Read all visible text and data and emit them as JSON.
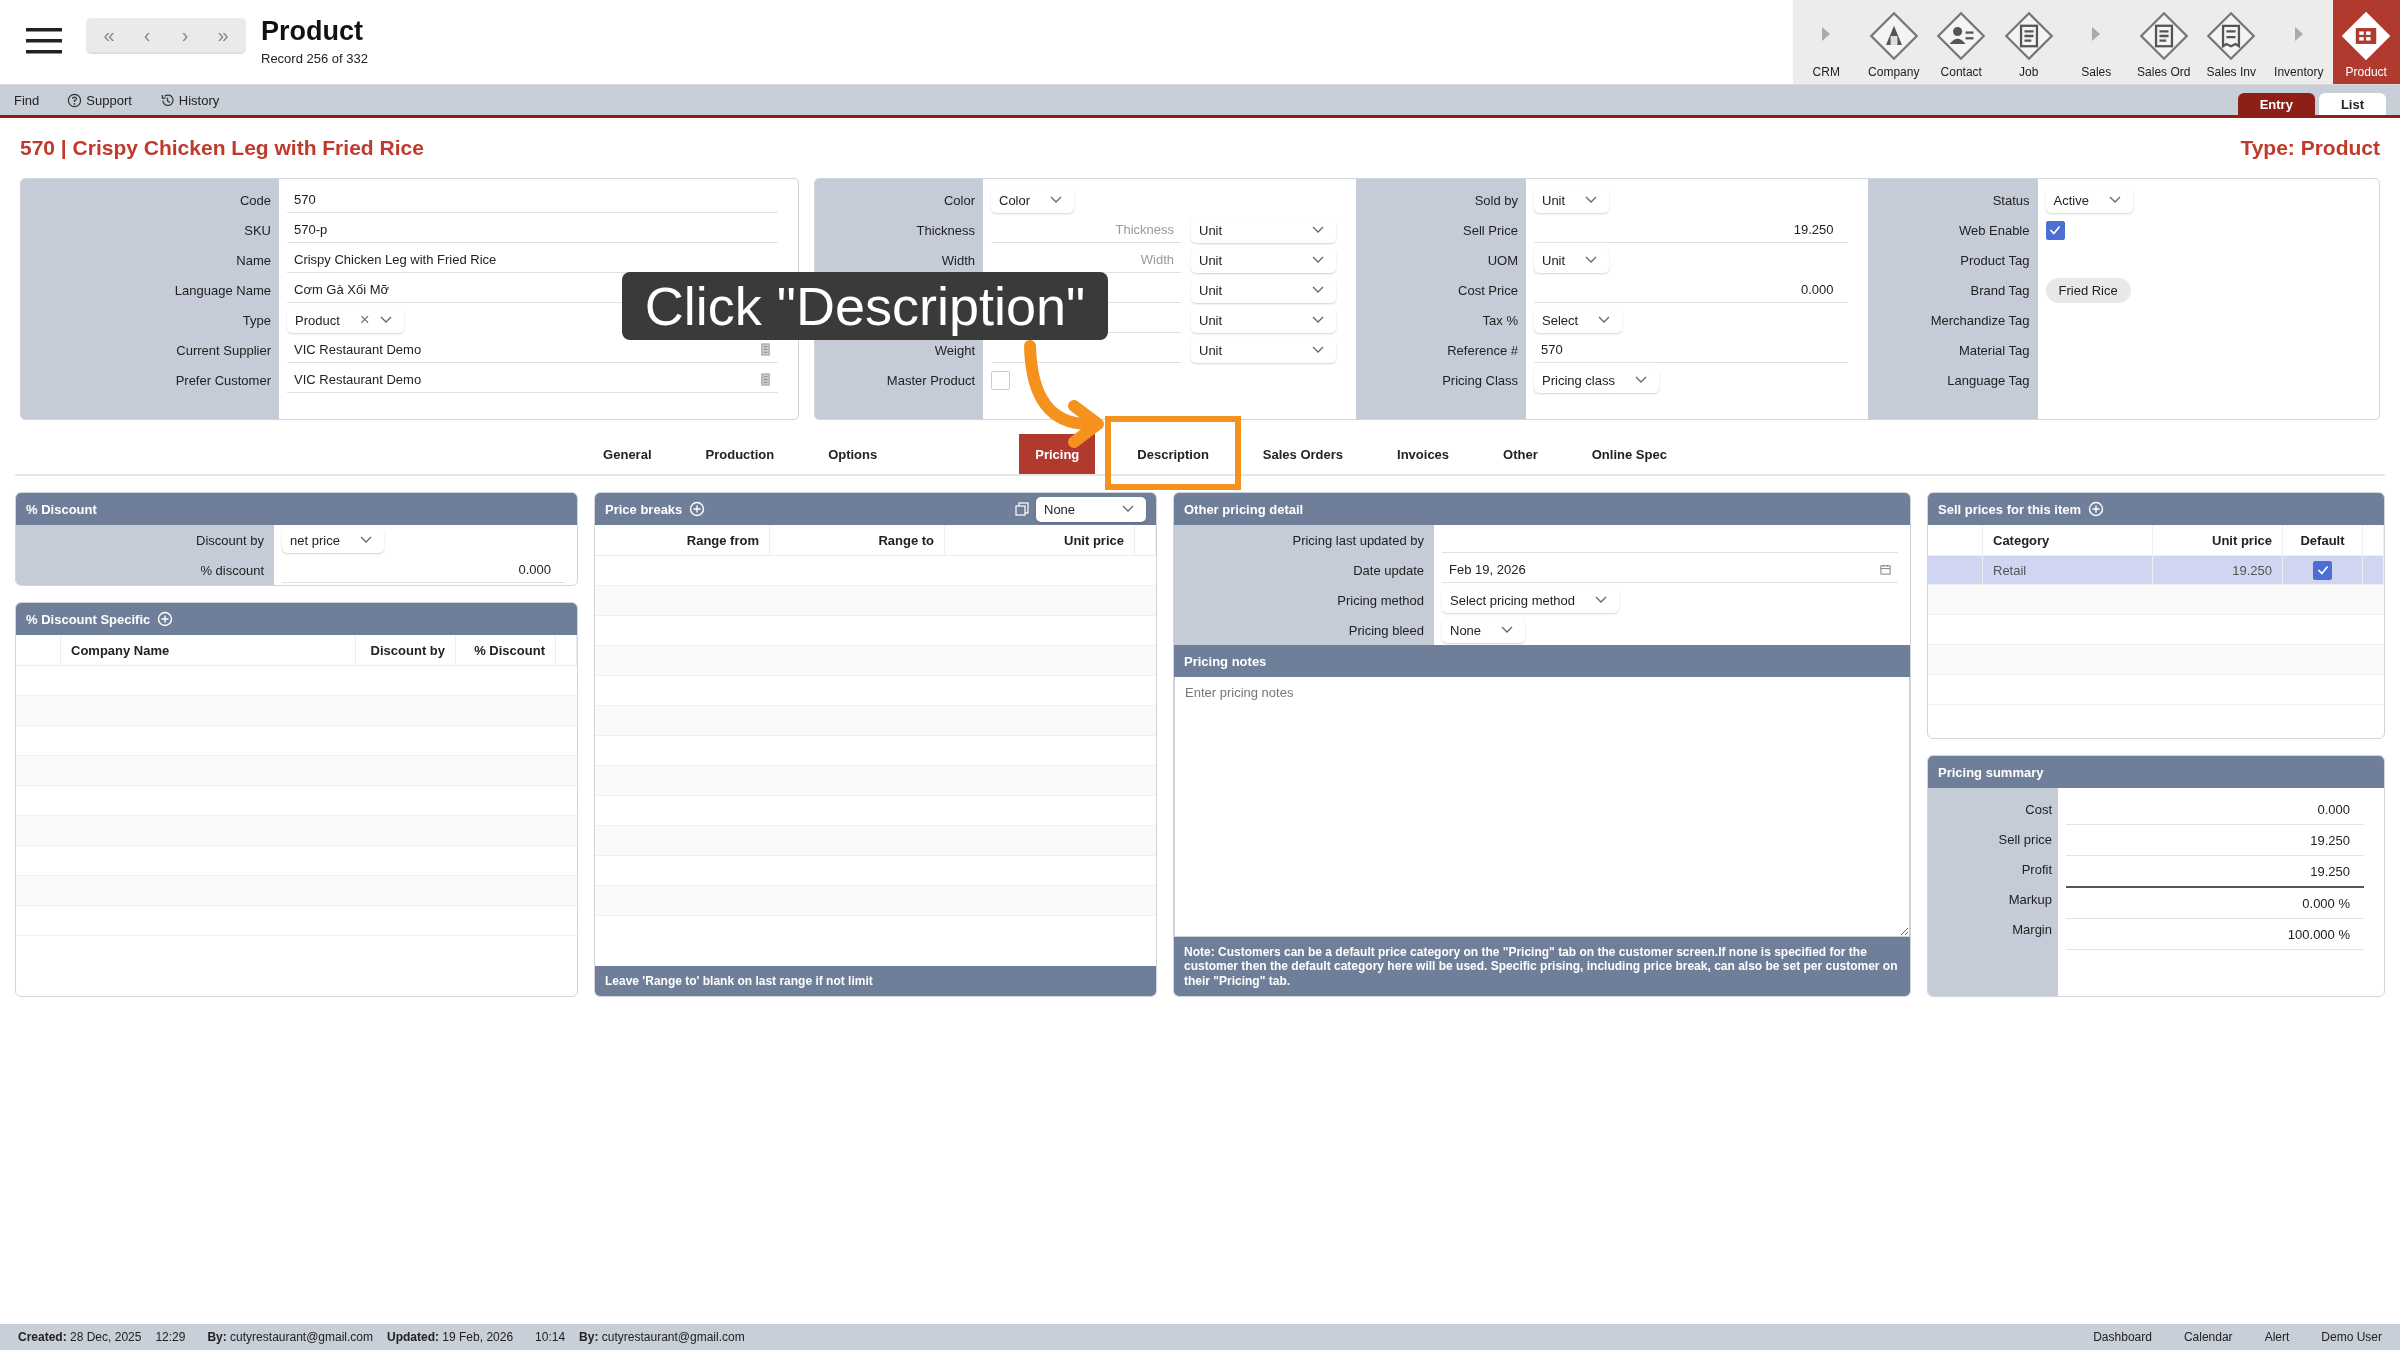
{
  "top_bar": {
    "nav_buttons": [
      "«",
      "‹",
      "›",
      "»"
    ],
    "title": "Product",
    "subtitle": "Record 256 of 332"
  },
  "modules": [
    {
      "label": "CRM",
      "kind": "group",
      "selected": false
    },
    {
      "label": "Company",
      "kind": "module",
      "selected": false
    },
    {
      "label": "Contact",
      "kind": "module",
      "selected": false
    },
    {
      "label": "Job",
      "kind": "module",
      "selected": false
    },
    {
      "label": "Sales",
      "kind": "group",
      "selected": false
    },
    {
      "label": "Sales Ord",
      "kind": "module",
      "selected": false
    },
    {
      "label": "Sales Inv",
      "kind": "module",
      "selected": false
    },
    {
      "label": "Inventory",
      "kind": "group",
      "selected": false
    },
    {
      "label": "Product",
      "kind": "module",
      "selected": true
    }
  ],
  "toolbar": [
    {
      "label": "Find",
      "kind": "plain"
    },
    {
      "label": "Support",
      "kind": "help"
    },
    {
      "label": "History",
      "kind": "history"
    }
  ],
  "view_tabs": [
    {
      "label": "Entry",
      "selected": true
    },
    {
      "label": "List",
      "selected": false
    }
  ],
  "record_heading": "570 | Crispy Chicken Leg with Fried Rice",
  "record_type": "Type: Product",
  "form_panels": [
    {
      "rows": [
        {
          "label": "Code",
          "kind": "text",
          "value": "570"
        },
        {
          "label": "SKU",
          "kind": "text",
          "value": "570-p"
        },
        {
          "label": "Name",
          "kind": "text",
          "value": "Crispy Chicken Leg with Fried Rice"
        },
        {
          "label": "Language Name",
          "kind": "text",
          "value": "Cơm Gà Xối Mỡ"
        },
        {
          "label": "Type",
          "kind": "select-clear",
          "value": "Product",
          "clear": "×"
        },
        {
          "label": "Current Supplier",
          "kind": "lookup",
          "value": "VIC Restaurant Demo"
        },
        {
          "label": "Prefer Customer",
          "kind": "lookup",
          "value": "VIC Restaurant Demo"
        }
      ]
    },
    {
      "rows": [
        {
          "label": "Color",
          "kind": "select",
          "value": "Color"
        },
        {
          "label": "Thickness",
          "kind": "dim",
          "placeholder": "Thickness",
          "unit": "Unit"
        },
        {
          "label": "Width",
          "kind": "dim",
          "placeholder": "Width",
          "unit": "Unit"
        },
        {
          "kind": "dim",
          "unit": "Unit"
        },
        {
          "kind": "dim",
          "unit": "Unit"
        },
        {
          "label": "Weight",
          "kind": "dim",
          "unit": "Unit"
        },
        {
          "label": "Master Product",
          "kind": "checkbox",
          "checked": false
        }
      ]
    },
    {
      "rows": [
        {
          "label": "Sold by",
          "kind": "select",
          "value": "Unit"
        },
        {
          "label": "Sell Price",
          "kind": "number",
          "value": "19.250"
        },
        {
          "label": "UOM",
          "kind": "select",
          "value": "Unit"
        },
        {
          "label": "Cost Price",
          "kind": "number",
          "value": "0.000"
        },
        {
          "label": "Tax %",
          "kind": "select",
          "value": "Select"
        },
        {
          "label": "Reference #",
          "kind": "text",
          "value": "570"
        },
        {
          "label": "Pricing Class",
          "kind": "select",
          "value": "Pricing class"
        }
      ]
    },
    {
      "rows": [
        {
          "label": "Status",
          "kind": "select",
          "value": "Active"
        },
        {
          "label": "Web Enable",
          "kind": "checkbox",
          "checked": true
        },
        {
          "label": "Product Tag",
          "kind": "tag"
        },
        {
          "label": "Brand Tag",
          "kind": "tag",
          "value": "Fried Rice"
        },
        {
          "label": "Merchandize Tag",
          "kind": "tag"
        },
        {
          "label": "Material Tag",
          "kind": "tag"
        },
        {
          "label": "Language Tag",
          "kind": "tag"
        }
      ]
    }
  ],
  "section_tabs": [
    {
      "label": "General",
      "selected": false,
      "highlighted": false
    },
    {
      "label": "Production",
      "selected": false,
      "highlighted": false
    },
    {
      "label": "Options",
      "selected": false,
      "highlighted": false
    },
    {
      "label": "Pricing",
      "selected": true,
      "highlighted": false
    },
    {
      "label": "Description",
      "selected": false,
      "highlighted": true
    },
    {
      "label": "Sales Orders",
      "selected": false,
      "highlighted": false
    },
    {
      "label": "Invoices",
      "selected": false,
      "highlighted": false
    },
    {
      "label": "Other",
      "selected": false,
      "highlighted": false
    },
    {
      "label": "Online Spec",
      "selected": false,
      "highlighted": false
    }
  ],
  "callout": {
    "text": "Click \"Description\""
  },
  "discount": {
    "title": "% Discount",
    "rows": [
      {
        "label": "Discount by",
        "kind": "select",
        "value": "net price"
      },
      {
        "label": "% discount",
        "kind": "number",
        "value": "0.000"
      }
    ]
  },
  "discount_specific": {
    "title": "% Discount Specific",
    "columns": [
      "Company Name",
      "Discount by",
      "% Discount"
    ]
  },
  "price_breaks": {
    "title": "Price breaks",
    "select": "None",
    "columns": [
      "Range from",
      "Range to",
      "Unit price"
    ],
    "footer": "Leave 'Range to' blank on last range if not limit"
  },
  "other_pricing": {
    "title": "Other pricing detail",
    "rows": [
      {
        "label": "Pricing last updated by",
        "kind": "text"
      },
      {
        "label": "Date update",
        "kind": "date",
        "value": "Feb 19, 2026"
      },
      {
        "label": "Pricing method",
        "kind": "select",
        "value": "Select pricing method"
      },
      {
        "label": "Pricing bleed",
        "kind": "select",
        "value": "None"
      }
    ]
  },
  "pricing_notes": {
    "title": "Pricing notes",
    "placeholder": "Enter pricing notes",
    "note": "Note: Customers can be a default price category on the \"Pricing\" tab on the customer screen.If none is specified for the customer then the default category here will be used. Specific prising, including price break, can also be set per customer on their \"Pricing\" tab."
  },
  "sell_prices": {
    "title": "Sell prices for this item",
    "columns": [
      "Category",
      "Unit price",
      "Default"
    ],
    "rows": [
      {
        "category": "Retail",
        "unit_price": "19.250",
        "default": true,
        "selected": true
      }
    ]
  },
  "pricing_summary": {
    "title": "Pricing summary",
    "rows": [
      {
        "label": "Cost",
        "value": "0.000"
      },
      {
        "label": "Sell price",
        "value": "19.250"
      },
      {
        "label": "Profit",
        "value": "19.250"
      },
      {
        "label": "Markup",
        "value": "0.000 %"
      },
      {
        "label": "Margin",
        "value": "100.000 %"
      }
    ]
  },
  "status_bar": {
    "left": [
      "**Created:** 28 Dec, 2025",
      "12:29",
      "**By:** cutyrestaurant@gmail.com",
      "**Updated:** 19 Feb, 2026",
      "10:14",
      "**By:** cutyrestaurant@gmail.com"
    ],
    "right": [
      "Dashboard",
      "Calendar",
      "Alert",
      "Demo User"
    ]
  }
}
